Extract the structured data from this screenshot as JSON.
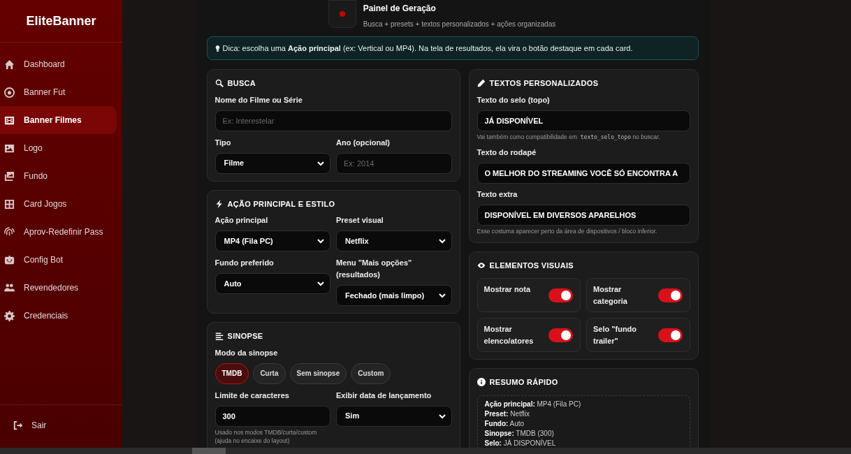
{
  "sidebar": {
    "brand": "EliteBanner",
    "items": [
      {
        "label": "Dashboard",
        "selected": false
      },
      {
        "label": "Banner Fut",
        "selected": false
      },
      {
        "label": "Banner Filmes",
        "selected": true
      },
      {
        "label": "Logo",
        "selected": false
      },
      {
        "label": "Fundo",
        "selected": false
      },
      {
        "label": "Card Jogos",
        "selected": false
      },
      {
        "label": "Aprov-Redefinir Pass",
        "selected": false
      },
      {
        "label": "Config Bot",
        "selected": false
      },
      {
        "label": "Revendedores",
        "selected": false
      },
      {
        "label": "Credenciais",
        "selected": false
      }
    ],
    "logout": "Sair"
  },
  "header": {
    "title": "Painel de Geração",
    "subtitle": "Busca + presets + textos personalizados + ações organizadas"
  },
  "tip": "Dica: escolha uma **Ação principal** (ex: Vertical ou MP4). Na tela de resultados, ela vira o botão destaque em cada card.",
  "left_sections": [
    {
      "kind": "search",
      "title": "BUSCA",
      "rows": [
        [
          {
            "kind": "text",
            "label": "Nome do Filme ou Série",
            "placeholder": "Ex: Interestelar"
          }
        ],
        [
          {
            "kind": "select",
            "label": "Tipo",
            "value": "Filme"
          },
          {
            "kind": "text",
            "label": "Ano (opcional)",
            "placeholder": "Ex: 2014"
          }
        ]
      ]
    },
    {
      "kind": "bolt",
      "title": "AÇÃO PRINCIPAL E ESTILO",
      "rows": [
        [
          {
            "kind": "select",
            "label": "Ação principal",
            "value": "MP4 (Fila PC)"
          },
          {
            "kind": "select",
            "label": "Preset visual",
            "value": "Netflix"
          }
        ],
        [
          {
            "kind": "select",
            "label": "Fundo preferido",
            "value": "Auto"
          },
          {
            "kind": "select",
            "label": "Menu \"Mais opções\" (resultados)",
            "value": "Fechado (mais limpo)"
          }
        ]
      ]
    },
    {
      "kind": "lines",
      "title": "SINOPSE",
      "rows": [
        [
          {
            "kind": "chips",
            "label": "Modo da sinopse",
            "options": [
              {
                "label": "TMDB",
                "selected": true
              },
              {
                "label": "Curta",
                "selected": false
              },
              {
                "label": "Sem sinopse",
                "selected": false
              },
              {
                "label": "Custom",
                "selected": false
              }
            ]
          }
        ],
        [
          {
            "kind": "text",
            "label": "Limite de caracteres",
            "value": "300",
            "help": [
              {
                "kind": "plain",
                "text": "Usado nos modos TMDB/curta/custom (ajuda no encaixe do layout)"
              }
            ]
          },
          {
            "kind": "select",
            "label": "Exibir data de lançamento",
            "value": "Sim"
          }
        ]
      ]
    }
  ],
  "texts_section": {
    "title": "TEXTOS PERSONALIZADOS",
    "fields": [
      {
        "kind": "text",
        "label": "Texto do selo (topo)",
        "value": "JÁ DISPONÍVEL",
        "help": [
          {
            "kind": "plain",
            "text": "Vai também como compatibilidade em"
          },
          {
            "kind": "code",
            "text": "texto_selo_topo"
          },
          {
            "kind": "plain",
            "text": "no buscar."
          }
        ]
      },
      {
        "kind": "text",
        "label": "Texto do rodapé",
        "value": "O MELHOR DO STREAMING VOCÊ SÓ ENCONTRA A"
      },
      {
        "kind": "text",
        "label": "Texto extra",
        "value": "DISPONÍVEL EM DIVERSOS APARELHOS",
        "help": [
          {
            "kind": "plain",
            "text": "Esse costuma aparecer perto da área de dispositivos / bloco inferior."
          }
        ]
      }
    ]
  },
  "visual_section": {
    "title": "ELEMENTOS VISUAIS",
    "toggles": [
      {
        "label": "Mostrar nota",
        "on": true
      },
      {
        "label": "Mostrar categoria",
        "on": true
      },
      {
        "label": "Mostrar elenco/atores",
        "on": true
      },
      {
        "label": "Selo \"fundo trailer\"",
        "on": true
      }
    ]
  },
  "summary_section": {
    "title": "RESUMO RÁPIDO",
    "lines": [
      {
        "label": "Ação principal:",
        "value": "MP4 (Fila PC)"
      },
      {
        "label": "Preset:",
        "value": "Netflix"
      },
      {
        "label": "Fundo:",
        "value": "Auto"
      },
      {
        "label": "Sinopse:",
        "value": "TMDB (300)"
      },
      {
        "label": "Selo:",
        "value": "JÁ DISPONÍVEL"
      }
    ]
  }
}
